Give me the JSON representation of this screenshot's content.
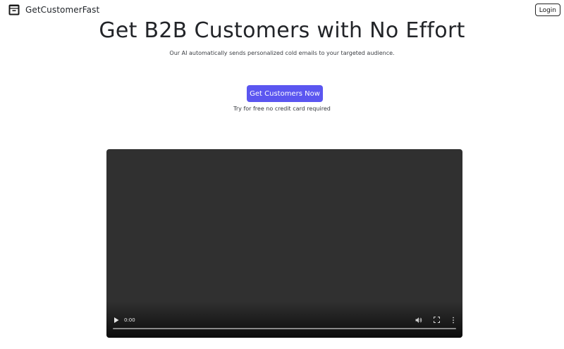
{
  "header": {
    "brand_name": "GetCustomerFast",
    "brand_icon": "archive-box-icon",
    "login_label": "Login"
  },
  "hero": {
    "title": "Get B2B Customers with No Effort",
    "subtitle": "Our AI automatically sends personalized cold emails to your targeted audience.",
    "cta_label": "Get Customers Now",
    "cta_note": "Try for free no credit card required"
  },
  "video": {
    "current_time": "0:00",
    "progress": 0,
    "icons": [
      "play-icon",
      "volume-icon",
      "fullscreen-icon",
      "more-options-icon"
    ]
  },
  "colors": {
    "accent": "#5b56f0",
    "text": "#1f2328",
    "video_background": "#303030"
  }
}
